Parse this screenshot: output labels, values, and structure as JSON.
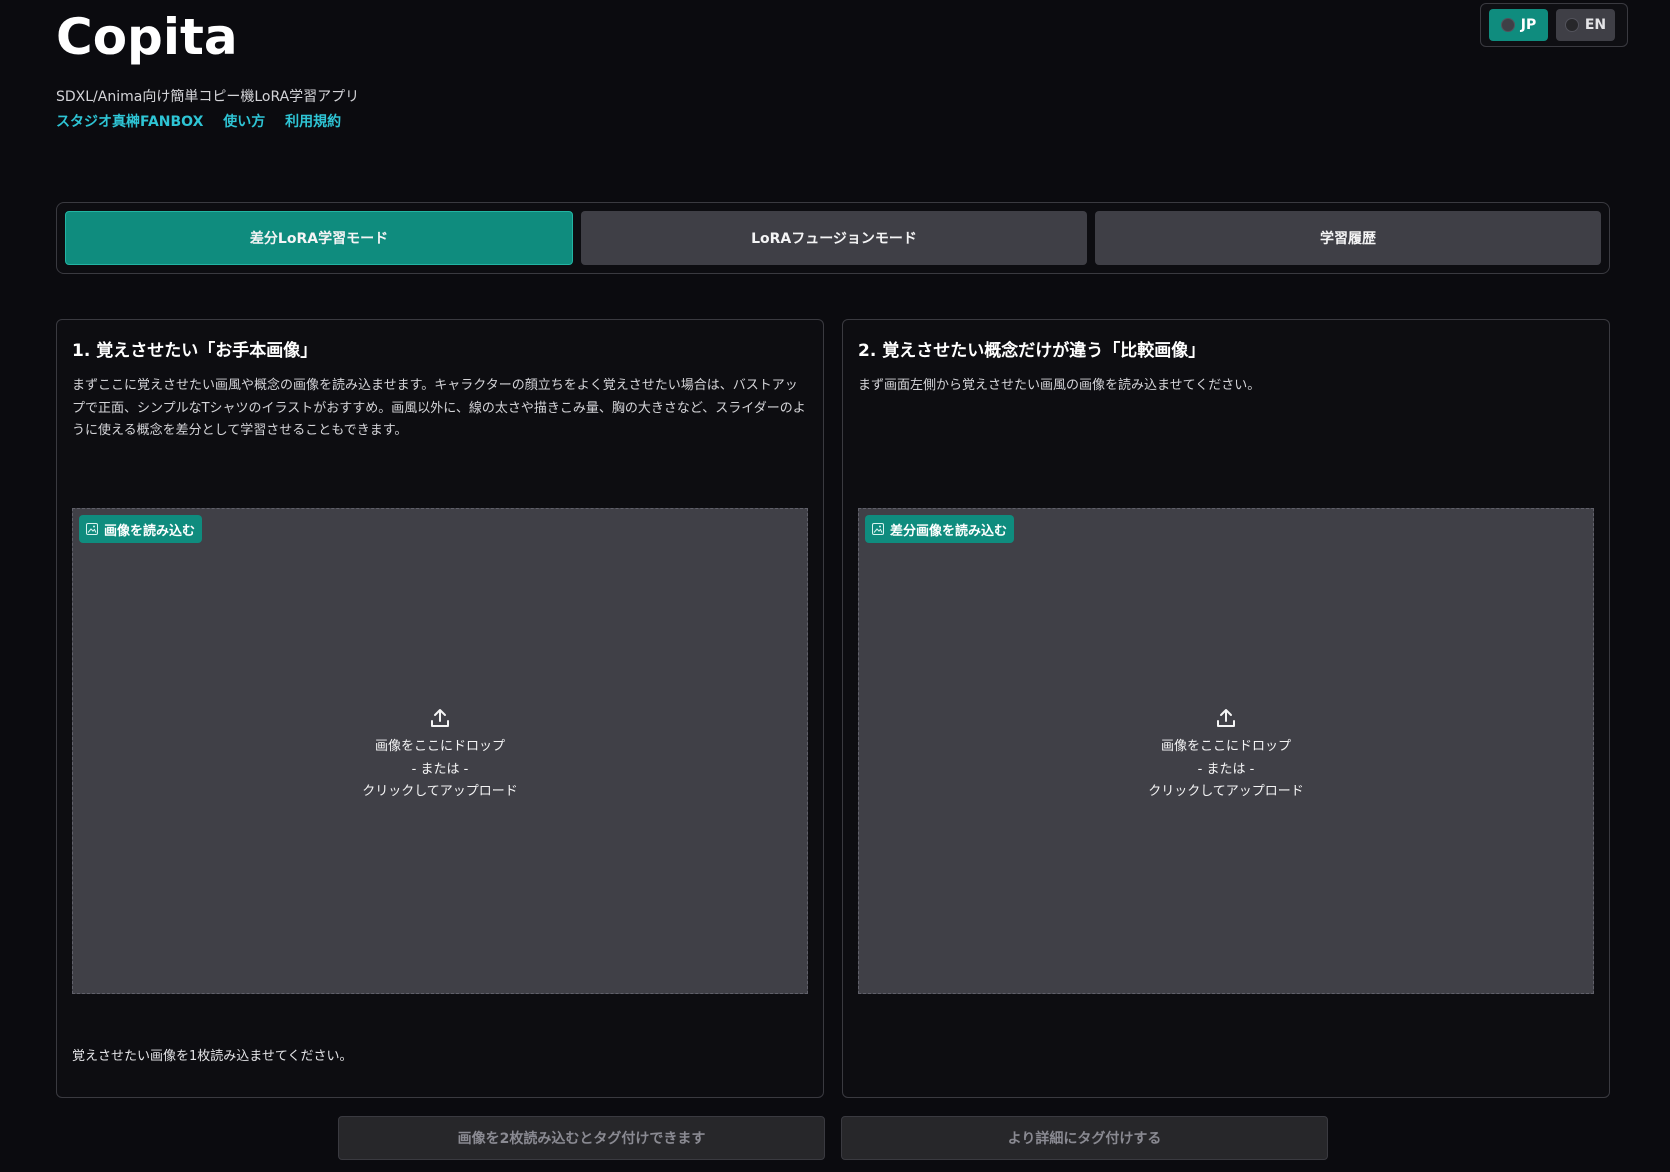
{
  "header": {
    "title": "Copita",
    "subtitle": "SDXL/Anima向け簡単コピー機LoRA学習アプリ",
    "links": [
      "スタジオ真榊FANBOX",
      "使い方",
      "利用規約"
    ]
  },
  "language": {
    "options": [
      {
        "label": "JP",
        "selected": true
      },
      {
        "label": "EN",
        "selected": false
      }
    ]
  },
  "tabs": [
    {
      "label": "差分LoRA学習モード",
      "active": true
    },
    {
      "label": "LoRAフュージョンモード",
      "active": false
    },
    {
      "label": "学習履歴",
      "active": false
    }
  ],
  "panels": {
    "left": {
      "title": "1. 覚えさせたい「お手本画像」",
      "description": "まずここに覚えさせたい画風や概念の画像を読み込ませます。キャラクターの顔立ちをよく覚えさせたい場合は、バストアップで正面、シンプルなTシャツのイラストがおすすめ。画風以外に、線の太さや描きこみ量、胸の大きさなど、スライダーのように使える概念を差分として学習させることもできます。",
      "upload_label": "画像を読み込む",
      "drop_text": "画像をここにドロップ",
      "or_text": "- または -",
      "click_text": "クリックしてアップロード",
      "note": "覚えさせたい画像を1枚読み込ませてください。"
    },
    "right": {
      "title": "2. 覚えさせたい概念だけが違う「比較画像」",
      "description": "まず画面左側から覚えさせたい画風の画像を読み込ませてください。",
      "upload_label": "差分画像を読み込む",
      "drop_text": "画像をここにドロップ",
      "or_text": "- または -",
      "click_text": "クリックしてアップロード"
    }
  },
  "actions": {
    "tag_button": "画像を2枚読み込むとタグ付けできます",
    "detail_tag_button": "より詳細にタグ付けする"
  },
  "colors": {
    "accent": "#0f8c7e",
    "link": "#2ec4d4",
    "background": "#0b0b0f"
  }
}
